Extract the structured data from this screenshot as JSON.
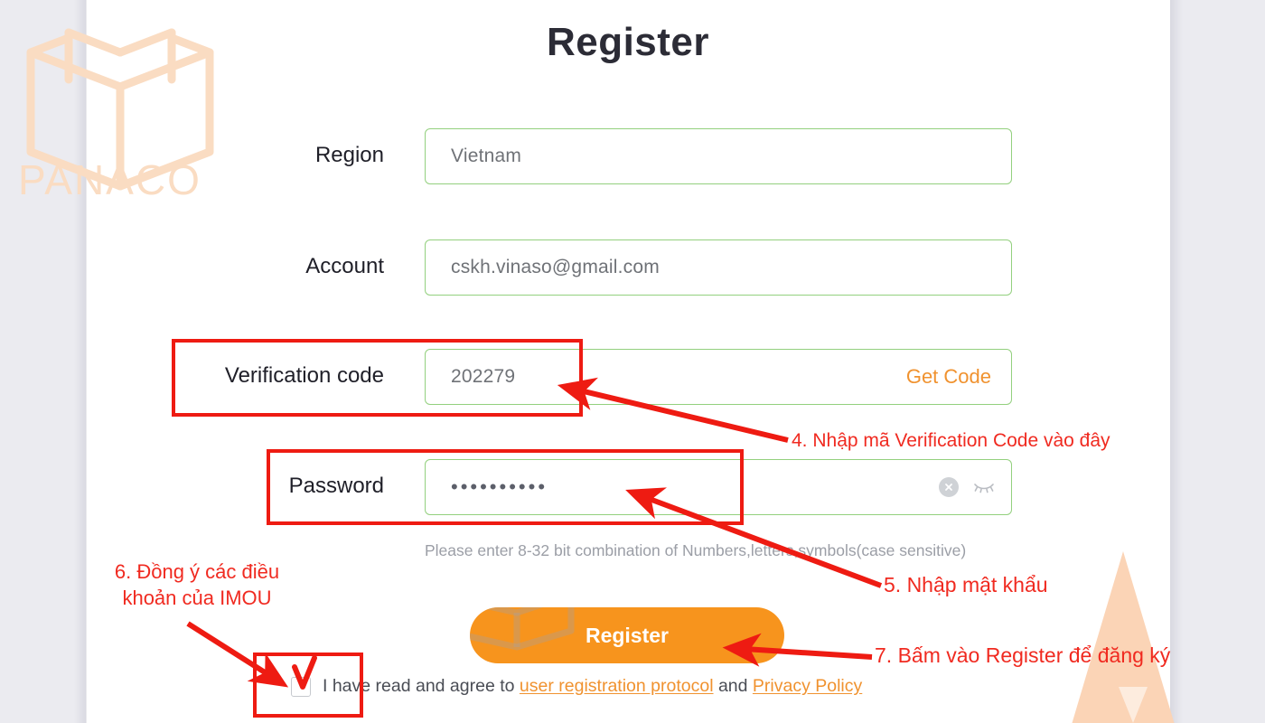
{
  "page": {
    "title": "Register",
    "background_color": "#ebebf0",
    "card_color": "#ffffff",
    "accent_color": "#f7941d",
    "field_border_color": "#93d07e",
    "annotation_color": "#ee1b12"
  },
  "watermark": {
    "brand": "PANACO",
    "logo_icon": "open-book-icon",
    "color": "#fadcc2"
  },
  "form": {
    "fields": [
      {
        "label": "Region",
        "value": "Vietnam",
        "name": "region"
      },
      {
        "label": "Account",
        "value": "cskh.vinaso@gmail.com",
        "name": "account"
      },
      {
        "label": "Verification code",
        "value": "202279",
        "name": "verification-code"
      },
      {
        "label": "Password",
        "value": "••••••••••",
        "name": "password"
      }
    ],
    "get_code_label": "Get Code",
    "password_hint": "Please enter 8-32 bit combination of Numbers,letters,symbols(case sensitive)",
    "password_clear_icon": "clear-circle-icon",
    "password_toggle_icon": "eye-closed-icon"
  },
  "submit": {
    "label": "Register"
  },
  "agreement": {
    "checkbox_checked": true,
    "prefix": "I have read and agree to ",
    "link_1": "user registration protocol",
    "conjunction": " and ",
    "link_2": "Privacy Policy"
  },
  "annotations": [
    {
      "id": "step4",
      "text": "4. Nhập mã Verification Code vào đây"
    },
    {
      "id": "step5",
      "text": "5. Nhập mật khẩu"
    },
    {
      "id": "step6",
      "text": "6. Đồng ý các điều\nkhoản của IMOU"
    },
    {
      "id": "step7",
      "text": "7. Bấm vào Register để đăng ký"
    }
  ]
}
